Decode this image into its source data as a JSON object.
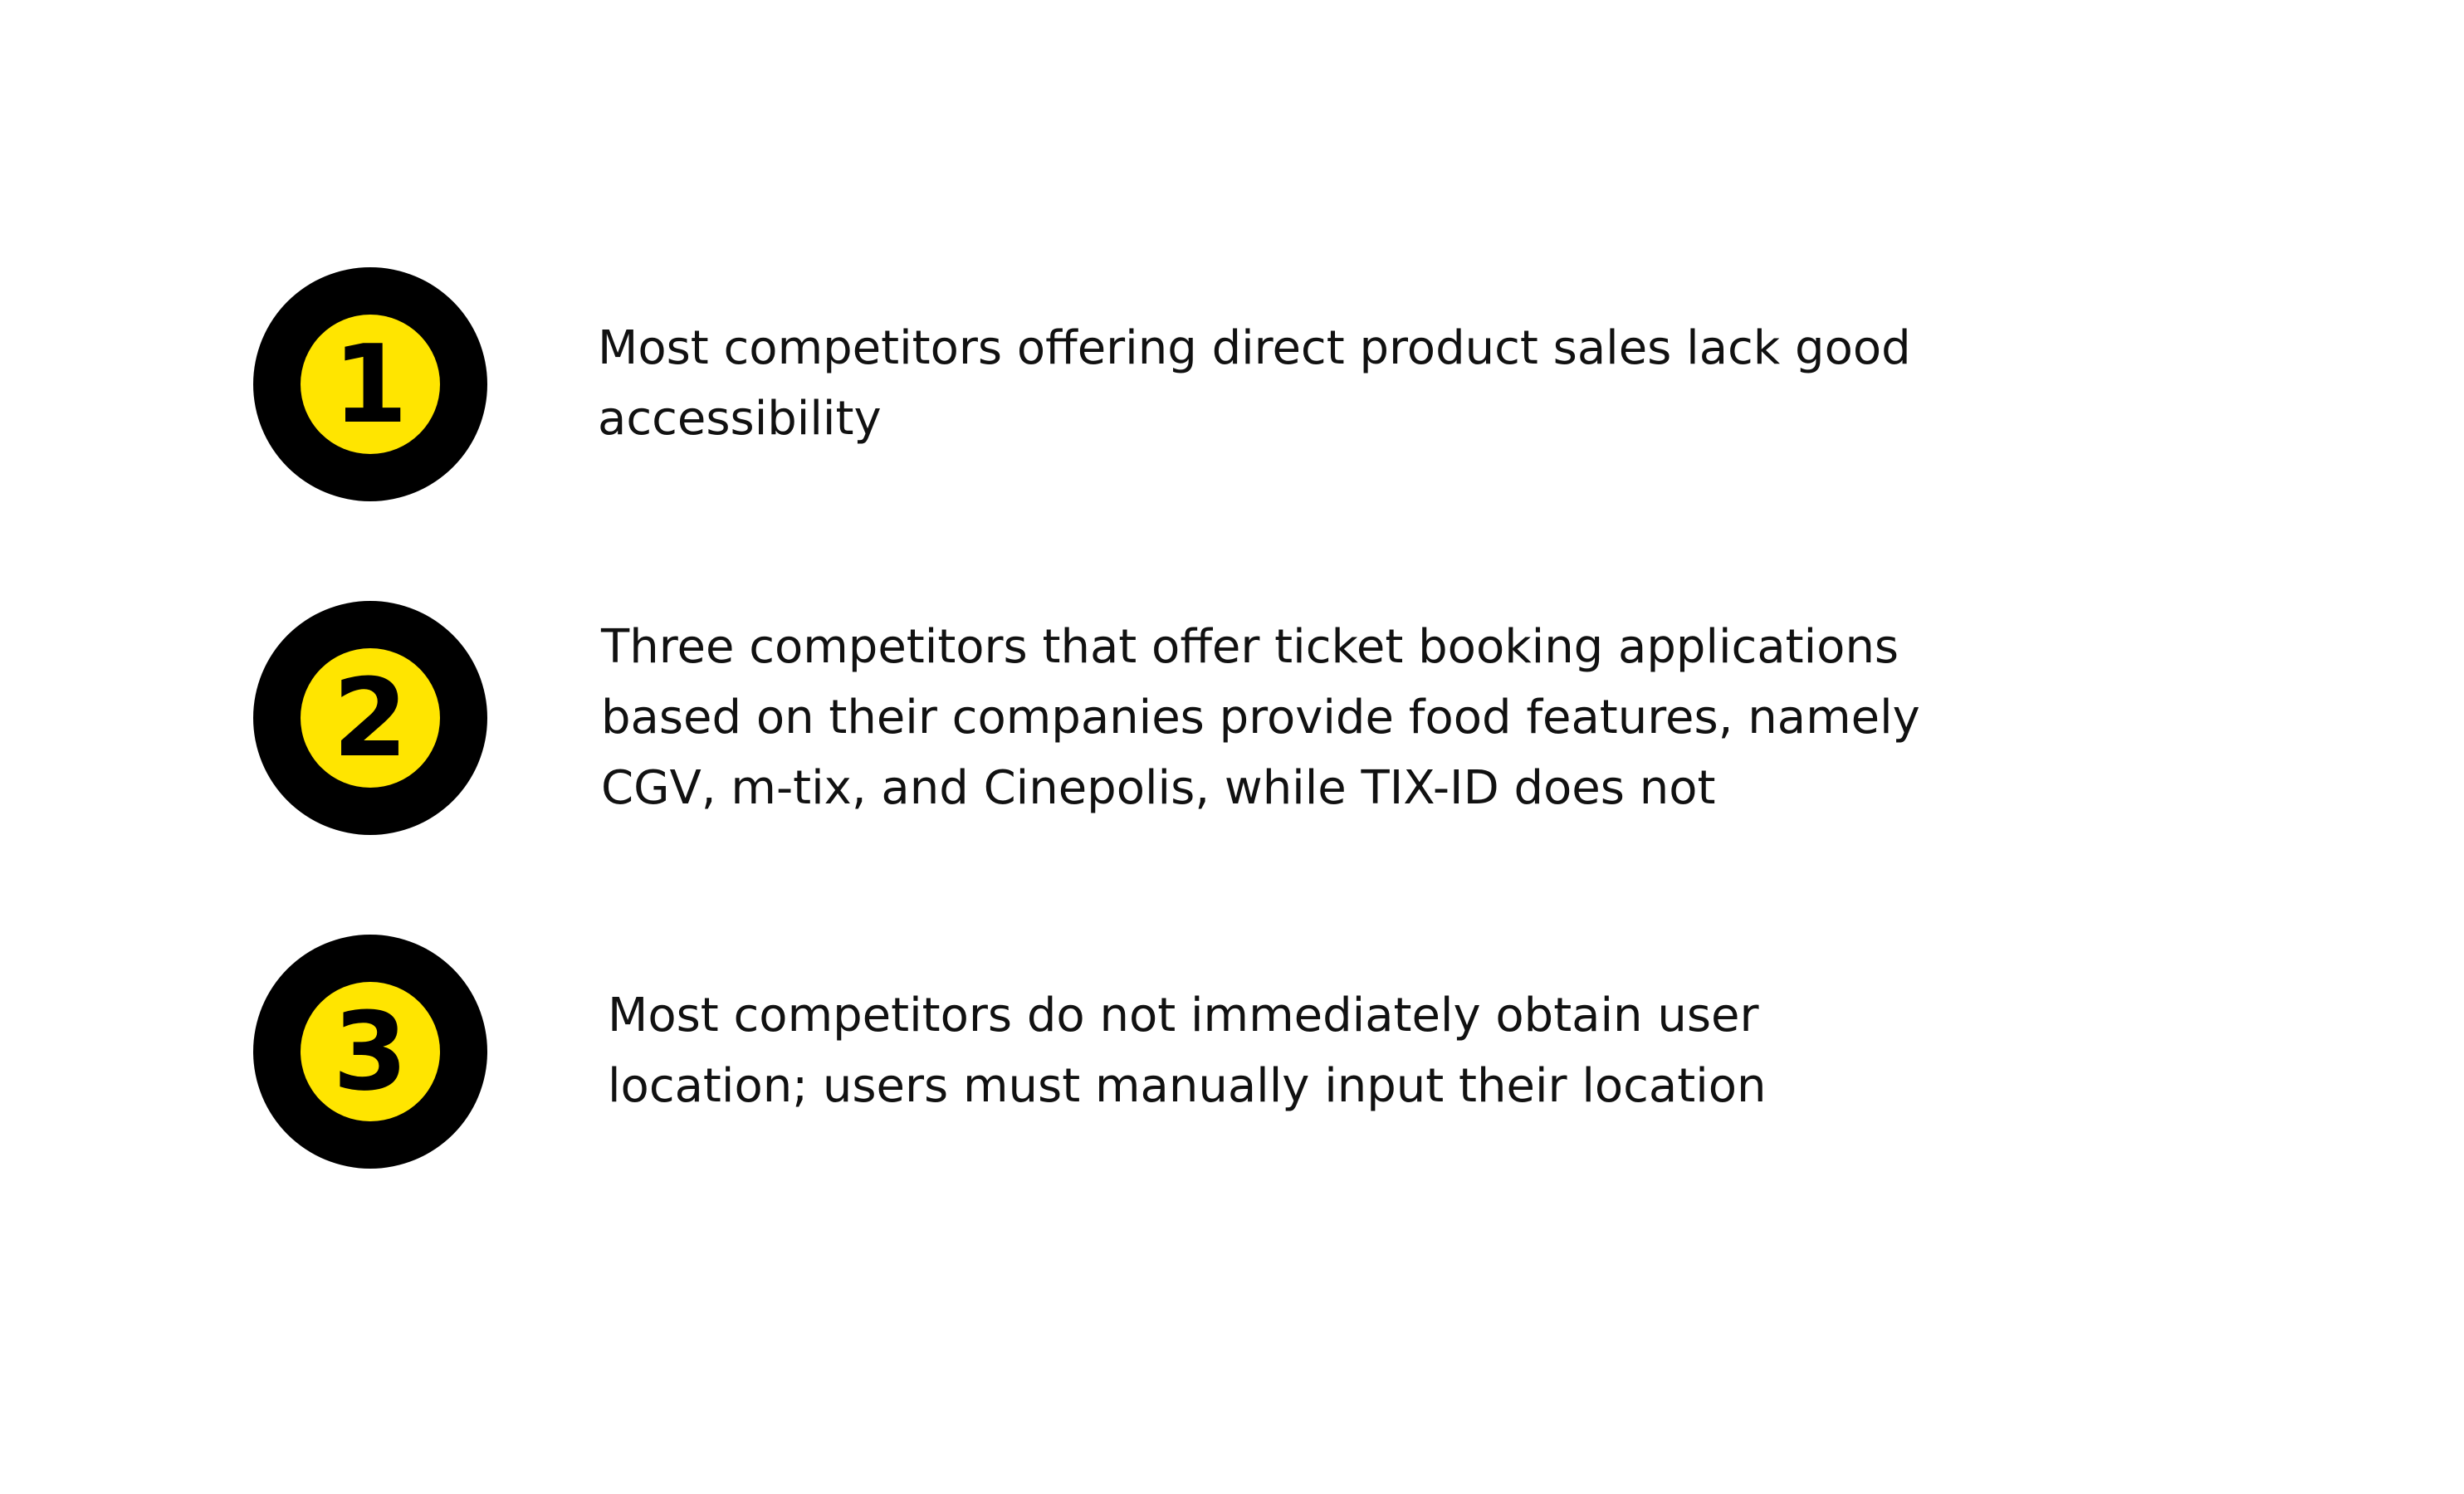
{
  "colors": {
    "background": "#ffffff",
    "badge_outer": "#000000",
    "badge_inner": "#ffe500",
    "text": "#111111"
  },
  "items": [
    {
      "number": "1",
      "text": "Most competitors offering direct product sales lack good accessibility"
    },
    {
      "number": "2",
      "text": "Three competitors that offer ticket booking applications based on their companies provide food features, namely CGV, m-tix, and Cinepolis, while TIX-ID does not"
    },
    {
      "number": "3",
      "text": "Most competitors do not immediately obtain user location; users must manually input their location"
    }
  ]
}
